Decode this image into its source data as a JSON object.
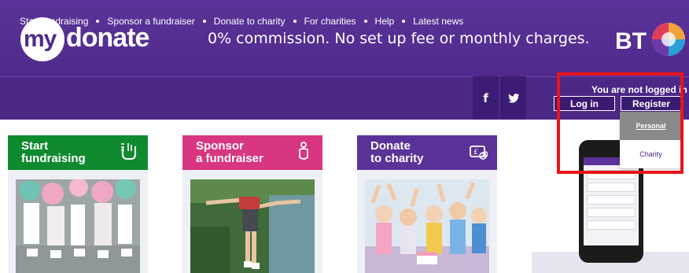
{
  "header": {
    "logo_my": "my",
    "logo_donate": "donate",
    "tagline": "0% commission. No set up fee or monthly charges.",
    "brand": "BT"
  },
  "nav": {
    "items": [
      "Start fundraising",
      "Sponsor a fundraiser",
      "Donate to charity",
      "For charities",
      "Help",
      "Latest news"
    ],
    "social": [
      "f",
      "twitter-bird"
    ]
  },
  "account": {
    "status": "You are not logged in",
    "login_label": "Log in",
    "register_label": "Register",
    "register_menu": [
      "Personal",
      "Charity"
    ],
    "register_menu_selected": "Personal"
  },
  "cards": [
    {
      "title": "Start\nfundraising",
      "icon": "raised-hands-icon",
      "color": "#0f8a2f"
    },
    {
      "title": "Sponsor\na fundraiser",
      "icon": "person-icon",
      "color": "#d8367f"
    },
    {
      "title": "Donate\nto charity",
      "icon": "pound-coins-icon",
      "color": "#5b3398"
    }
  ],
  "colors": {
    "header": "#5b3398",
    "nav": "#4b2886",
    "highlight": "#e8141b"
  }
}
